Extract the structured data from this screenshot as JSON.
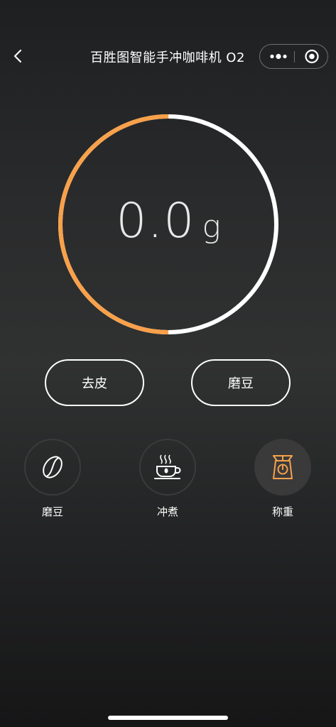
{
  "header": {
    "title": "百胜图智能手冲咖啡机 O2"
  },
  "scale": {
    "value": "0.0",
    "unit": "g",
    "progress_fraction": 0.5,
    "accent_color": "#f8a14a"
  },
  "actions": {
    "tare_label": "去皮",
    "grind_label": "磨豆"
  },
  "modes": [
    {
      "label": "磨豆",
      "icon": "coffee-bean-icon",
      "active": false
    },
    {
      "label": "冲煮",
      "icon": "coffee-cup-icon",
      "active": false
    },
    {
      "label": "称重",
      "icon": "weighing-scale-icon",
      "active": true
    }
  ]
}
